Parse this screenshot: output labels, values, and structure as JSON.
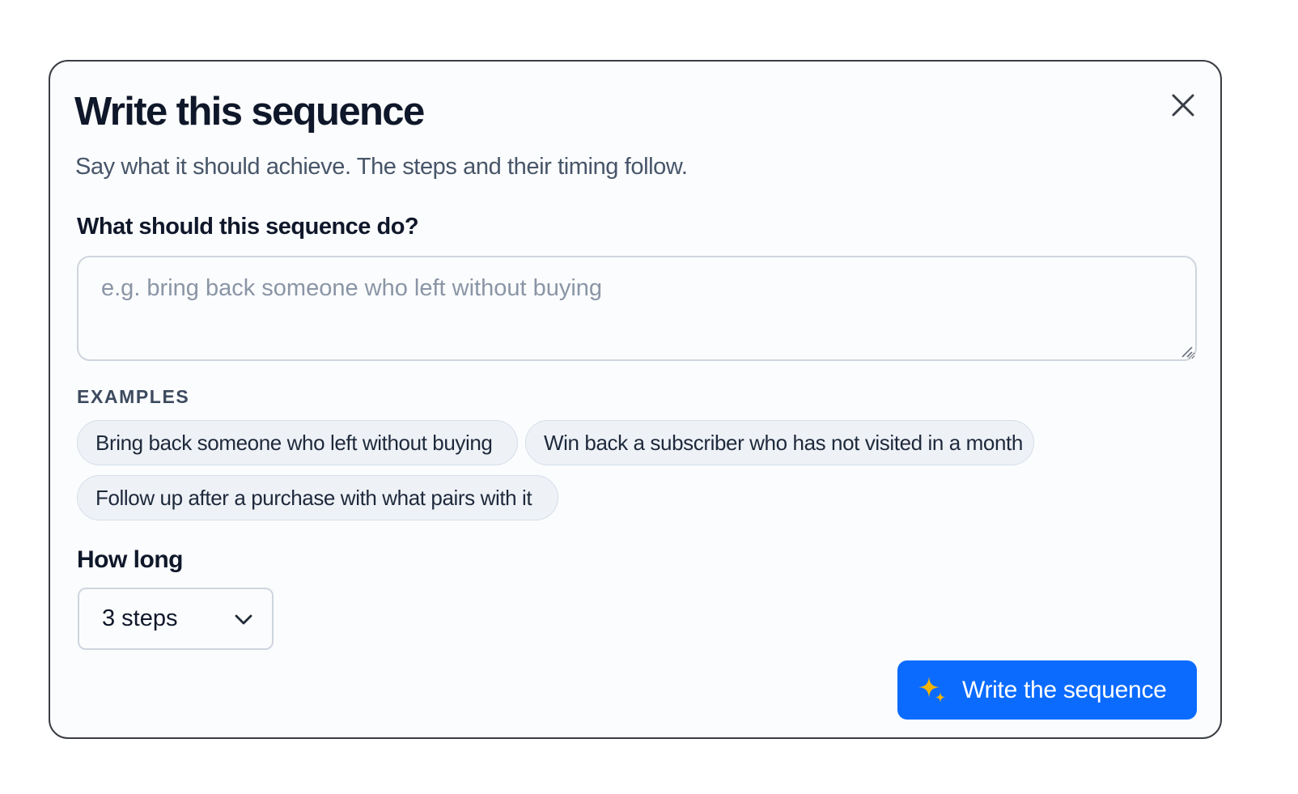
{
  "dialog": {
    "title": "Write this sequence",
    "subtitle": "Say what it should achieve. The steps and their timing follow.",
    "close_icon": "close-icon"
  },
  "goal": {
    "label": "What should this sequence do?",
    "value": "",
    "placeholder": "e.g. bring back someone who left without buying"
  },
  "examples": {
    "heading": "EXAMPLES",
    "items": [
      "Bring back someone who left without buying",
      "Win back a subscriber who has not visited in a month",
      "Follow up after a purchase with what pairs with it"
    ]
  },
  "length": {
    "label": "How long",
    "selected": "3 steps",
    "icon": "chevron-down-icon"
  },
  "submit": {
    "label": "Write the sequence",
    "icon": "sparkle-icon"
  },
  "colors": {
    "primary": "#0b6bff",
    "sparkle": "#f5b400",
    "chip_bg": "#eef2f7",
    "border": "#3a3d44"
  }
}
